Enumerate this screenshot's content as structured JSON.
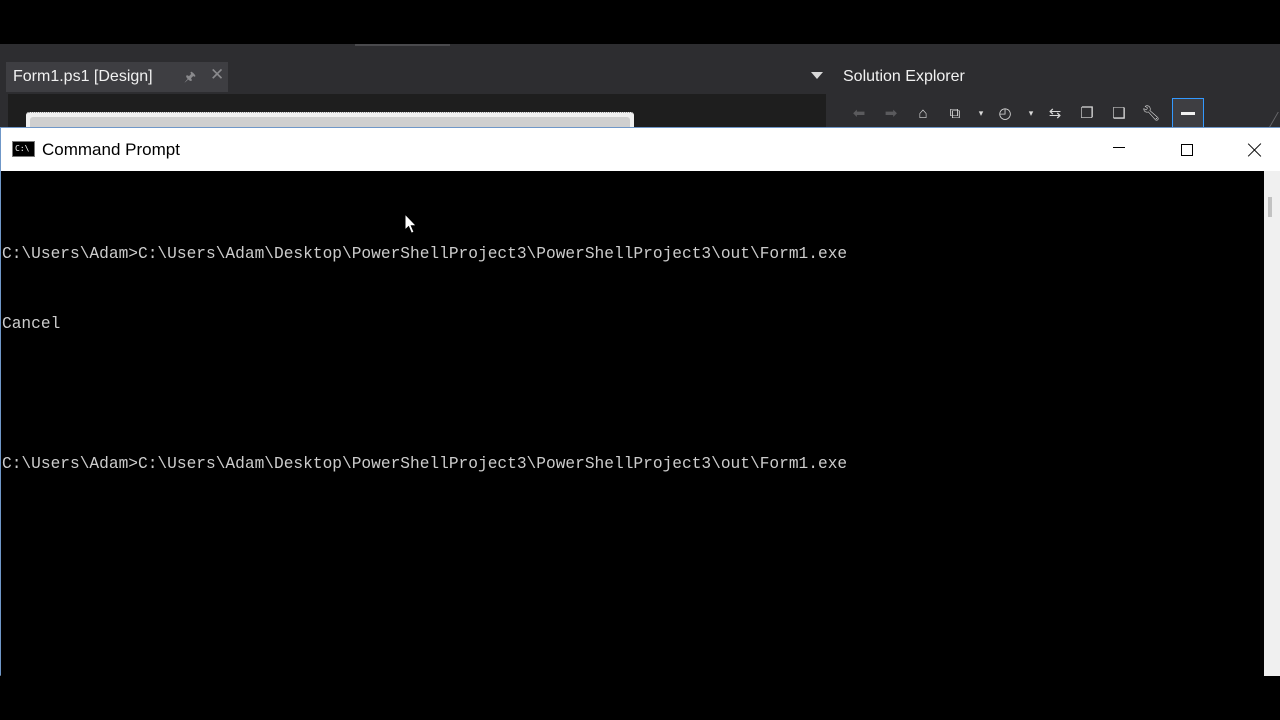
{
  "vs": {
    "document_tab": {
      "label": "Form1.ps1 [Design]",
      "pin_icon": "pin-icon",
      "close_icon": "close-icon"
    },
    "solution_explorer": {
      "title": "Solution Explorer",
      "toolbar_icons": [
        "back-icon",
        "forward-icon",
        "home-icon",
        "switch-views-icon",
        "pending-changes-filter-icon",
        "sync-icon",
        "collapse-all-icon",
        "show-all-files-icon",
        "properties-icon",
        "preview-icon"
      ]
    }
  },
  "cmd": {
    "title": "Command Prompt",
    "icon_glyph": "C:\\",
    "lines": [
      "C:\\Users\\Adam>C:\\Users\\Adam\\Desktop\\PowerShellProject3\\PowerShellProject3\\out\\Form1.exe",
      "Cancel",
      "",
      "C:\\Users\\Adam>C:\\Users\\Adam\\Desktop\\PowerShellProject3\\PowerShellProject3\\out\\Form1.exe"
    ]
  },
  "colors": {
    "vs_background": "#2d2d30",
    "console_background": "#000000",
    "console_text": "#cccccc",
    "titlebar_background": "#ffffff",
    "accent": "#3399ff"
  }
}
